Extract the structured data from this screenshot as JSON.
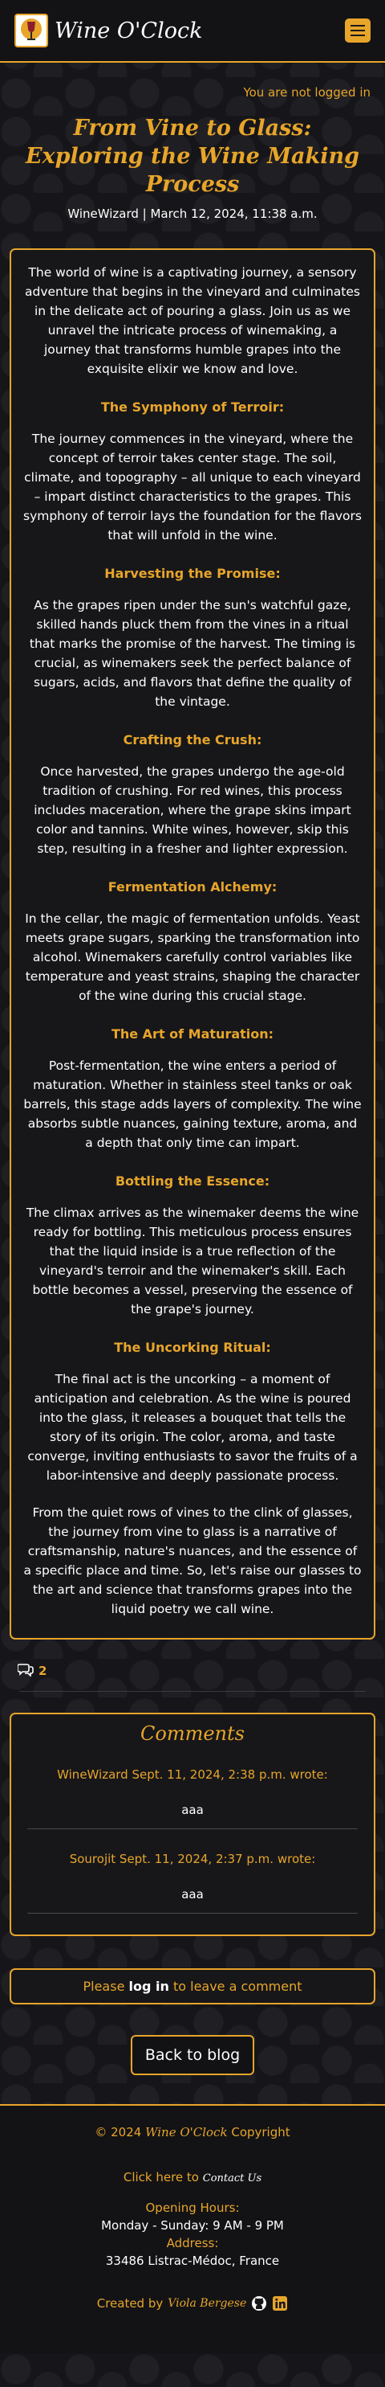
{
  "header": {
    "brand": "Wine O'Clock",
    "logo_icon": "wine-glass-icon",
    "menu_icon": "hamburger-icon"
  },
  "auth": {
    "status": "You are not logged in"
  },
  "post": {
    "title": "From Vine to Glass: Exploring the Wine Making Process",
    "meta": "WineWizard | March 12, 2024, 11:38 a.m.",
    "intro": "The world of wine is a captivating journey, a sensory adventure that begins in the vineyard and culminates in the delicate act of pouring a glass. Join us as we unravel the intricate process of winemaking, a journey that transforms humble grapes into the exquisite elixir we know and love.",
    "sections": [
      {
        "heading": "The Symphony of Terroir:",
        "text": "The journey commences in the vineyard, where the concept of terroir takes center stage. The soil, climate, and topography – all unique to each vineyard – impart distinct characteristics to the grapes. This symphony of terroir lays the foundation for the flavors that will unfold in the wine."
      },
      {
        "heading": "Harvesting the Promise:",
        "text": "As the grapes ripen under the sun's watchful gaze, skilled hands pluck them from the vines in a ritual that marks the promise of the harvest. The timing is crucial, as winemakers seek the perfect balance of sugars, acids, and flavors that define the quality of the vintage."
      },
      {
        "heading": "Crafting the Crush:",
        "text": "Once harvested, the grapes undergo the age-old tradition of crushing. For red wines, this process includes maceration, where the grape skins impart color and tannins. White wines, however, skip this step, resulting in a fresher and lighter expression."
      },
      {
        "heading": "Fermentation Alchemy:",
        "text": "In the cellar, the magic of fermentation unfolds. Yeast meets grape sugars, sparking the transformation into alcohol. Winemakers carefully control variables like temperature and yeast strains, shaping the character of the wine during this crucial stage."
      },
      {
        "heading": "The Art of Maturation:",
        "text": "Post-fermentation, the wine enters a period of maturation. Whether in stainless steel tanks or oak barrels, this stage adds layers of complexity. The wine absorbs subtle nuances, gaining texture, aroma, and a depth that only time can impart."
      },
      {
        "heading": "Bottling the Essence:",
        "text": "The climax arrives as the winemaker deems the wine ready for bottling. This meticulous process ensures that the liquid inside is a true reflection of the vineyard's terroir and the winemaker's skill. Each bottle becomes a vessel, preserving the essence of the grape's journey."
      },
      {
        "heading": "The Uncorking Ritual:",
        "text": "The final act is the uncorking – a moment of anticipation and celebration. As the wine is poured into the glass, it releases a bouquet that tells the story of its origin. The color, aroma, and taste converge, inviting enthusiasts to savor the fruits of a labor-intensive and deeply passionate process."
      }
    ],
    "outro": "From the quiet rows of vines to the clink of glasses, the journey from vine to glass is a narrative of craftsmanship, nature's nuances, and the essence of a specific place and time. So, let's raise our glasses to the art and science that transforms grapes into the liquid poetry we call wine."
  },
  "comment_count": {
    "icon": "comments-icon",
    "value": "2"
  },
  "comments": {
    "title": "Comments",
    "items": [
      {
        "author_line": "WineWizard Sept. 11, 2024, 2:38 p.m. wrote:",
        "body": "aaa"
      },
      {
        "author_line": "Sourojit Sept. 11, 2024, 2:37 p.m. wrote:",
        "body": "aaa"
      }
    ]
  },
  "login_prompt": {
    "before": "Please",
    "link": "log in",
    "after": "to leave a comment"
  },
  "back_button": "Back to blog",
  "footer": {
    "copy_prefix": "© 2024",
    "copy_brand": "Wine O'Clock",
    "copy_suffix": "Copyright",
    "contact_prefix": "Click here to",
    "contact_link": "Contact Us",
    "hours_label": "Opening Hours:",
    "hours": "Monday - Sunday: 9 AM - 9 PM",
    "address_label": "Address:",
    "address": "33486 Listrac-Médoc, France",
    "credits_prefix": "Created by",
    "credits_name": "Viola Bergese",
    "icons": [
      "github-icon",
      "linkedin-icon"
    ]
  },
  "colors": {
    "accent": "#e7a52a",
    "background": "#16161a",
    "text": "#ffffff"
  }
}
